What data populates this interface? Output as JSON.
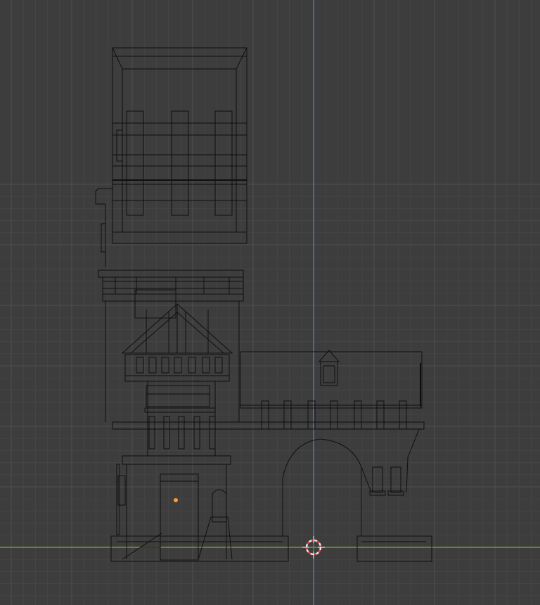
{
  "viewport": {
    "view": "front-orthographic",
    "shading": "wireframe",
    "background_color": "#3d3d3d",
    "grid_minor_color": "#454545",
    "grid_major_color": "#505050",
    "axis_x_color": "#6f9f1f",
    "axis_z_color": "#4f78b0",
    "wire_color": "#0f0f0f",
    "origin_color": "#ff9a2e",
    "cursor_color": "#e9ecec",
    "cursor_accent_color": "#d84848"
  },
  "scene": {
    "object_type": "building-mesh",
    "parts": [
      "tower",
      "roof-cap",
      "balcony-ledge",
      "gable-porch",
      "front-door",
      "side-wing",
      "arch-gateway",
      "dormer-window"
    ]
  }
}
